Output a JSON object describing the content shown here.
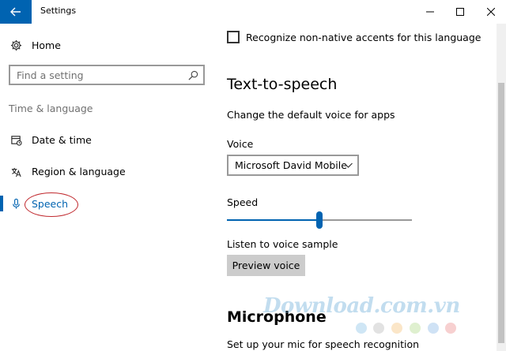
{
  "window": {
    "title": "Settings",
    "controls": {
      "minimize": "minimize",
      "maximize": "maximize",
      "close": "close"
    }
  },
  "sidebar": {
    "home": {
      "label": "Home",
      "icon": "gear-icon"
    },
    "search": {
      "placeholder": "Find a setting",
      "icon": "search-icon"
    },
    "section": "Time & language",
    "items": [
      {
        "label": "Date & time",
        "icon": "calendar-icon",
        "active": false
      },
      {
        "label": "Region & language",
        "icon": "region-language-icon",
        "active": false
      },
      {
        "label": "Speech",
        "icon": "microphone-icon",
        "active": true
      }
    ]
  },
  "main": {
    "checkbox": {
      "label": "Recognize non-native accents for this language",
      "checked": false
    },
    "tts": {
      "heading": "Text-to-speech",
      "description": "Change the default voice for apps",
      "voice_label": "Voice",
      "voice_selected": "Microsoft David Mobile",
      "speed_label": "Speed",
      "speed_value": 0.5,
      "listen_label": "Listen to voice sample",
      "preview_button": "Preview voice"
    },
    "microphone": {
      "heading": "Microphone",
      "description": "Set up your mic for speech recognition"
    }
  },
  "watermark": {
    "text": "Download.com.vn"
  },
  "colors": {
    "accent": "#0063b1",
    "highlight_ellipse": "#c0282d",
    "button_gray": "#cccccc"
  }
}
